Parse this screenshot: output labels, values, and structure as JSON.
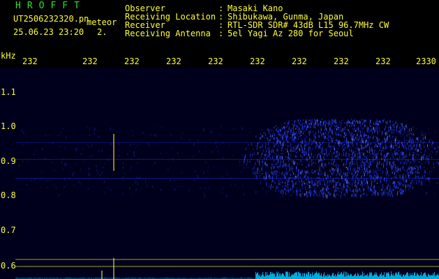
{
  "header": {
    "logo": "HROFFT",
    "filename": "UT2506232320.pn",
    "tag": "meteor",
    "datetime": "25.06.23 23:20",
    "index": "2.",
    "fields": [
      {
        "label": "Observer",
        "value": "Masaki Kano"
      },
      {
        "label": "Receiving Location",
        "value": "Shibukawa, Gunma, Japan"
      },
      {
        "label": "Receiver",
        "value": "RTL-SDR SDR# 43dB L15 96.7MHz CW"
      },
      {
        "label": "Receiving Antenna",
        "value": "5el Yagi Az 280 for Seoul"
      }
    ]
  },
  "axis": {
    "unit": "kHz",
    "time_ticks": [
      "232",
      "232",
      "232",
      "232",
      "232",
      "232",
      "232",
      "232",
      "232",
      "2330"
    ],
    "freq_ticks": [
      "1.1",
      "1.0",
      "0.9",
      "0.8",
      "0.7",
      "0.6"
    ]
  },
  "colors": {
    "text": "#ffff3a",
    "logo": "#2fe02f",
    "background": "#000000",
    "plot_bg": "#00001c",
    "noise": "#1a32ff",
    "meteor": "#ffd400",
    "baseline": "#00c8ff"
  }
}
